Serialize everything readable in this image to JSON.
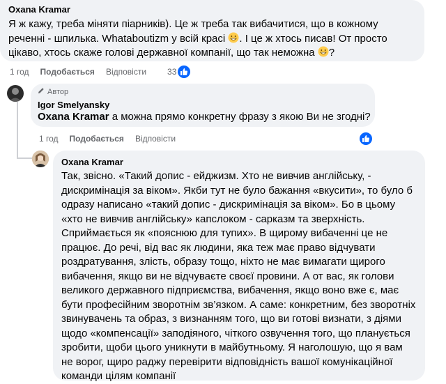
{
  "comment1": {
    "author": "Oxana Kramar",
    "text_part1": "Я ж кажу, треба міняти піарників). Це ж треба так вибачитися, що в кожному\nреченні - шпилька. Whataboutizm у всій красі ",
    "text_part2": ". І це ж хтось писав! От просто\nцікаво, хтось скаже голові державної компанії, що так неможна ",
    "text_part3": "?",
    "emoji_name": "grinning-face-icon",
    "time": "1 год",
    "like_label": "Подобається",
    "reply_label": "Відповісти",
    "reactions_count": "33"
  },
  "comment2": {
    "author_badge": "Автор",
    "author": "Igor Smelyansky",
    "mention": "Oxana Kramar",
    "text": " а можна прямо конкретну фразу з якою Ви не згодні?",
    "time": "1 год",
    "like_label": "Подобається",
    "reply_label": "Відповісти"
  },
  "comment3": {
    "author": "Oxana Kramar",
    "text": "Так, звісно. «Такий допис - ейджизм. Хто не вивчив англійську, -\nдискримінація за віком». Якби тут не було бажання «вкусити», то було б\nодразу написано «такий допис - дискримінація за віком». Бо в цьому\n«хто не вивчив англійську» капслоком - сарказм та зверхність.\nСприймається як «пояснюю для тупих». В щирому вибаченні це не\nпрацює. До речі, від вас як людини, яка теж має право відчувати\nроздратування, злість, образу тощо, ніхто не має вимагати щирого\nвибачення, якщо ви не відчуваєте своєї провини. А от вас, як голови\nвеликого державного підприємства, вибачення, якщо воно вже є, має\nбути професійним зворотнім зв’язком. А саме: конкретним, без зворотніх\nзвинувачень та образ, з визнанням того, що ви готові визнати, з діями\nщодо «компенсації» заподіяного, чіткого озвучення того, що планується\nзробити, щоби цього уникнути в майбутньому. Я наголошую, що я вам\nне ворог, щиро раджу перевірити відповідність вашої комунікаційної\nкоманди цілям компанії"
  },
  "colors": {
    "bubble": "#f0f2f5",
    "meta": "#65676b",
    "like_blue": "#0866ff"
  }
}
